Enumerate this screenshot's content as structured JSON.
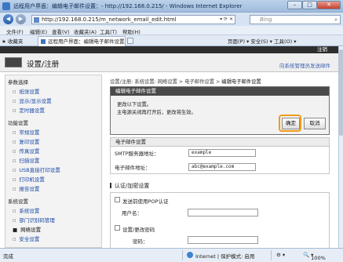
{
  "window": {
    "title": "远程用户界面：编辑电子邮件设置：- http://192.168.0.215/ - Windows Internet Explorer",
    "minimize": "–",
    "maximize": "□",
    "close": "✕"
  },
  "addressbar": {
    "back": "◀",
    "forward": "▶",
    "url": "http://192.168.0.215/m_network_email_edit.html",
    "search_placeholder": "Bing"
  },
  "menubar": [
    "文件(F)",
    "编辑(E)",
    "查看(V)",
    "收藏夹(A)",
    "工具(T)",
    "帮助(H)"
  ],
  "favbar": {
    "favorites": "收藏夹",
    "tab_title": "远程用户界面：编辑电子邮件设置：",
    "tools": "页面(P) ▾ 安全(S) ▾ 工具(O) ▾"
  },
  "page": {
    "logout": "注销",
    "title": "设置/注册",
    "mail_link": "向系统管理员发送邮件"
  },
  "sidebar": {
    "sections": [
      {
        "label": "参数选择",
        "items": [
          {
            "label": "纸张设置"
          },
          {
            "label": "显示/显示设置"
          },
          {
            "label": "定时器设置"
          }
        ]
      },
      {
        "label": "功能设置",
        "items": [
          {
            "label": "常规设置"
          },
          {
            "label": "复印设置"
          },
          {
            "label": "传真设置"
          },
          {
            "label": "扫描设置"
          },
          {
            "label": "USB直接打印设置"
          },
          {
            "label": "打印机设置"
          },
          {
            "label": "报告设置"
          }
        ]
      },
      {
        "label": "系统设置",
        "items": [
          {
            "label": "系统设置"
          },
          {
            "label": "部门识别码管理"
          },
          {
            "label": "网络设置",
            "active": true
          },
          {
            "label": "安全设置"
          }
        ]
      }
    ]
  },
  "breadcrumb": {
    "path": "设置/注册: 系统设置: 网络设置 > 电子邮件设置 >",
    "current": "编辑电子邮件设置"
  },
  "dialog": {
    "header": "编辑电子邮件设置",
    "line1": "更改以下设置。",
    "line2": "主电源关闭再打开后，更改将生效。",
    "ok": "确定",
    "cancel": "取消"
  },
  "email_settings": {
    "header": "电子邮件设置",
    "smtp_label": "SMTP服务器地址：",
    "smtp_value": "example",
    "addr_label": "电子邮件地址：",
    "addr_value": "abc@example.com"
  },
  "auth": {
    "header": "认证/加密设置",
    "pop_label": "发送前使用POP认证",
    "user_label": "用户名：",
    "pw_set_label": "设置/更改密码",
    "pw_label": "密码："
  },
  "statusbar": {
    "done": "完成",
    "zone": "Internet | 保护模式: 启用",
    "zoom": "100%"
  }
}
